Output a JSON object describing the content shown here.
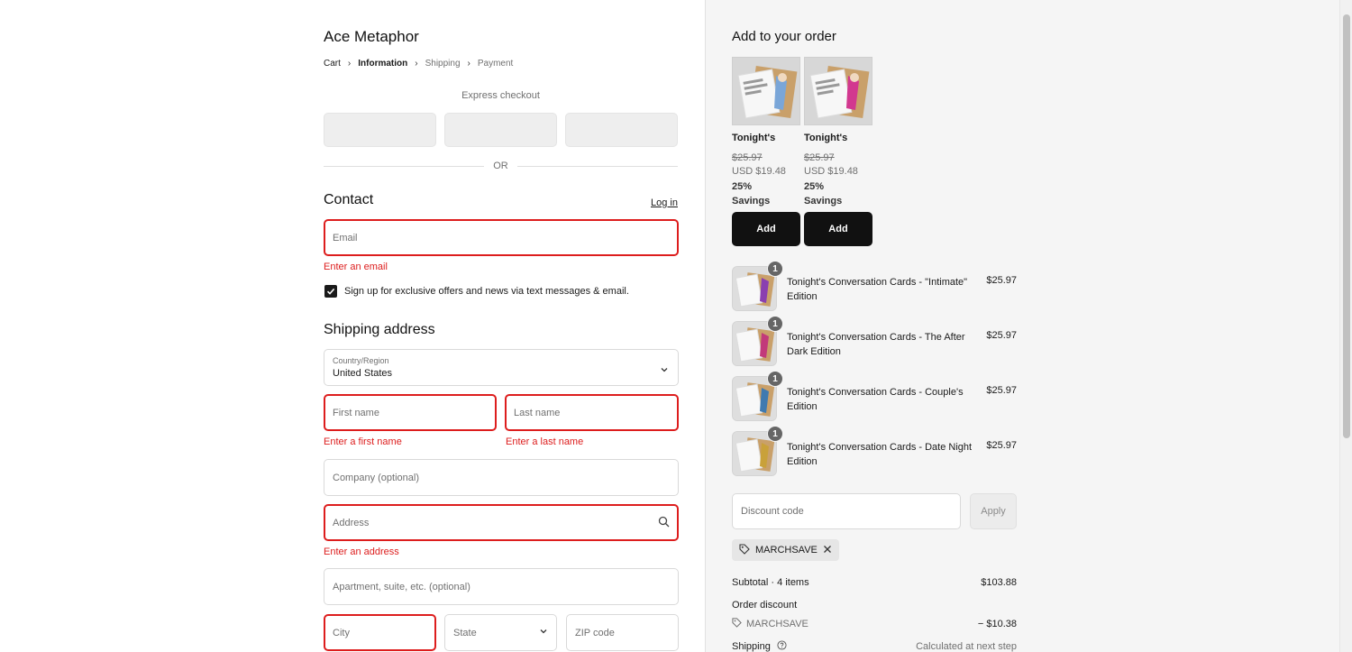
{
  "store": {
    "name": "Ace Metaphor"
  },
  "breadcrumb": [
    {
      "label": "Cart"
    },
    {
      "label": "Information"
    },
    {
      "label": "Shipping"
    },
    {
      "label": "Payment"
    }
  ],
  "express": {
    "label": "Express checkout",
    "or": "OR"
  },
  "contact": {
    "title": "Contact",
    "login": "Log in",
    "email_placeholder": "Email",
    "email_error": "Enter an email",
    "signup_label": "Sign up for exclusive offers and news via text messages & email."
  },
  "shipping": {
    "title": "Shipping address",
    "country_label": "Country/Region",
    "country_value": "United States",
    "first_name_placeholder": "First name",
    "first_name_error": "Enter a first name",
    "last_name_placeholder": "Last name",
    "last_name_error": "Enter a last name",
    "company_placeholder": "Company (optional)",
    "address_placeholder": "Address",
    "address_error": "Enter an address",
    "apartment_placeholder": "Apartment, suite, etc. (optional)",
    "city_placeholder": "City",
    "state_placeholder": "State",
    "zip_placeholder": "ZIP code"
  },
  "upsell": {
    "title": "Add to your order",
    "items": [
      {
        "name": "Tonight's",
        "old_price": "$25.97",
        "new_price": "USD $19.48",
        "savings_pct": "25%",
        "savings_label": "Savings",
        "button": "Add"
      },
      {
        "name": "Tonight's",
        "old_price": "$25.97",
        "new_price": "USD $19.48",
        "savings_pct": "25%",
        "savings_label": "Savings",
        "button": "Add"
      }
    ]
  },
  "cart": {
    "items": [
      {
        "qty": "1",
        "title": "Tonight's Conversation Cards - \"Intimate\" Edition",
        "price": "$25.97",
        "accent": "#8a3fb0"
      },
      {
        "qty": "1",
        "title": "Tonight's Conversation Cards - The After Dark Edition",
        "price": "$25.97",
        "accent": "#c23a7a"
      },
      {
        "qty": "1",
        "title": "Tonight's Conversation Cards - Couple's Edition",
        "price": "$25.97",
        "accent": "#3f7ab0"
      },
      {
        "qty": "1",
        "title": "Tonight's Conversation Cards - Date Night Edition",
        "price": "$25.97",
        "accent": "#c9a13a"
      }
    ]
  },
  "discount": {
    "placeholder": "Discount code",
    "apply": "Apply",
    "applied_code": "MARCHSAVE"
  },
  "summary": {
    "subtotal_label": "Subtotal · 4 items",
    "subtotal_value": "$103.88",
    "order_discount_label": "Order discount",
    "discount_code": "MARCHSAVE",
    "discount_value": "− $10.38",
    "shipping_label": "Shipping",
    "shipping_value": "Calculated at next step"
  },
  "colors": {
    "error": "#dd1d1d",
    "button": "#111111",
    "sidebar_bg": "#f5f5f5"
  }
}
